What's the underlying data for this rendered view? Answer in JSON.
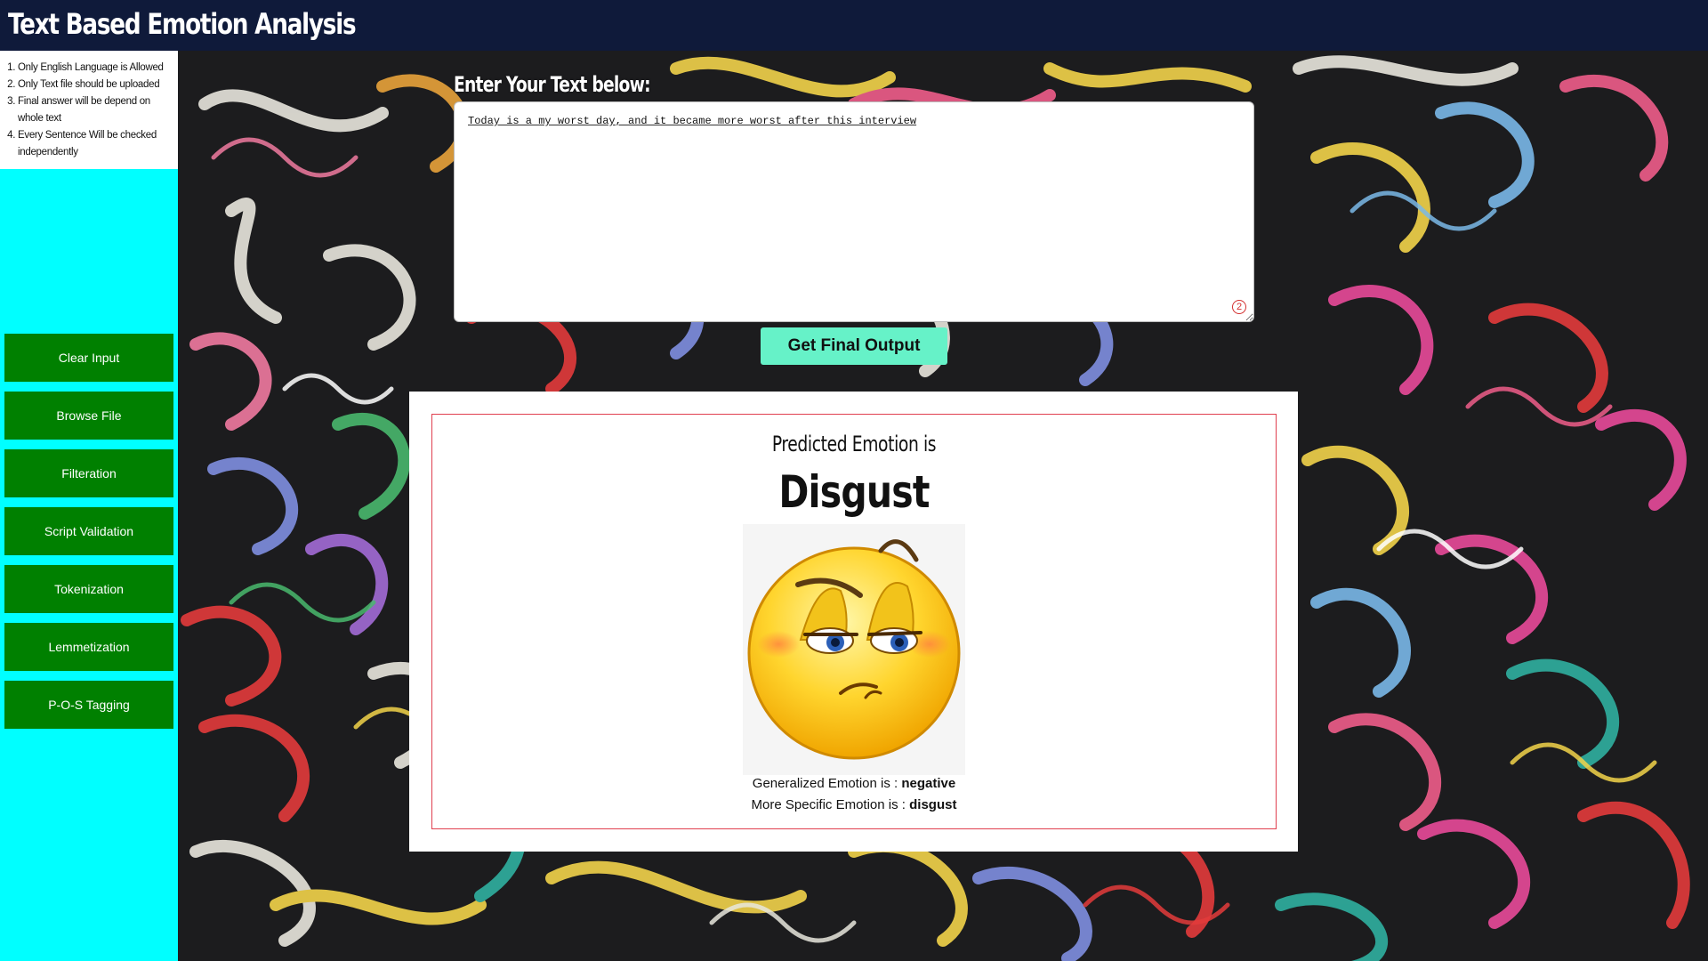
{
  "app": {
    "title": "Text Based Emotion Analysis"
  },
  "instructions": [
    "Only English Language is Allowed",
    "Only Text file should be uploaded",
    "Final answer will be depend on whole text",
    "Every Sentence Will be checked independently"
  ],
  "sidebar": {
    "buttons": [
      "Clear Input",
      "Browse File",
      "Filteration",
      "Script Validation",
      "Tokenization",
      "Lemmetization",
      "P-O-S Tagging"
    ]
  },
  "input": {
    "label": "Enter Your Text below:",
    "value": "Today is a my worst day, and it became more worst after this interview",
    "grammar_issue_count": "2"
  },
  "action": {
    "button_label": "Get Final Output"
  },
  "result": {
    "heading": "Predicted Emotion is",
    "emotion": "Disgust",
    "emoji_icon": "smirking-disgust-face-icon",
    "generalized_label": "Generalized Emotion is : ",
    "generalized_value": "negative",
    "specific_label": "More Specific Emotion is : ",
    "specific_value": "disgust"
  },
  "colors": {
    "header_bg": "#0f1a3a",
    "sidebar_bg": "#00ffff",
    "sidebar_button_bg": "#008000",
    "primary_button_bg": "#66f2c8",
    "result_border": "#e0404f"
  }
}
